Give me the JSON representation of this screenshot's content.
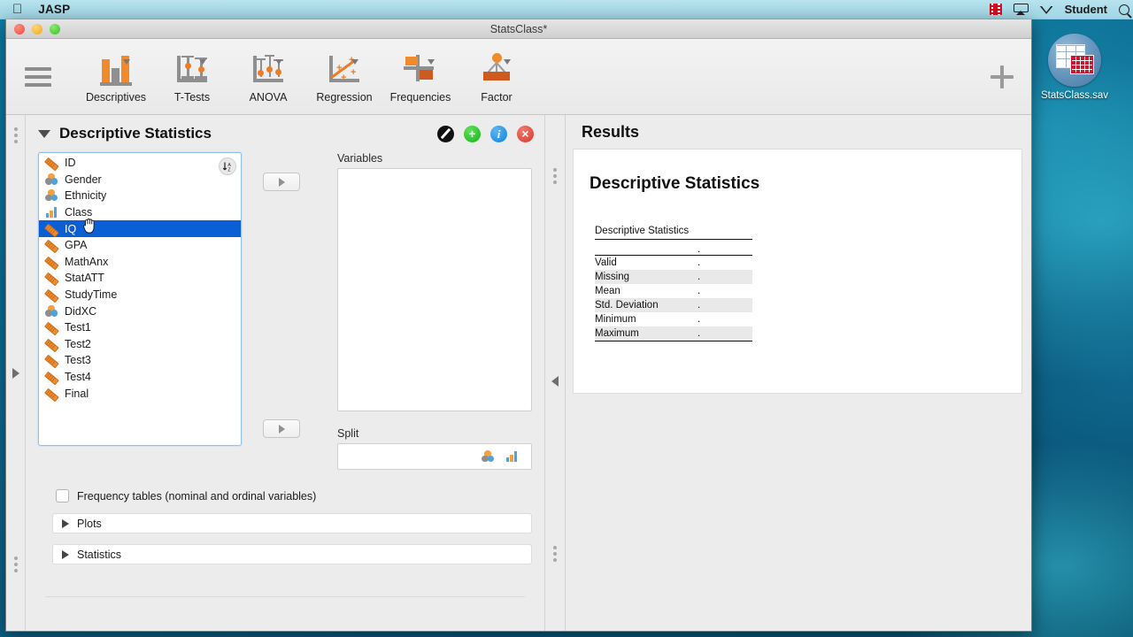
{
  "menubar": {
    "apple_icon": "apple-icon",
    "app_name": "JASP",
    "user": "Student",
    "status_icons": [
      "screen-recorder-icon",
      "airplay-icon",
      "wifi-icon",
      "spotlight-icon"
    ]
  },
  "desktop": {
    "file_icon": {
      "label": "StatsClass.sav",
      "icon": "spss-data-file-icon"
    },
    "wallpaper_color": "#0a6e97"
  },
  "window": {
    "title": "StatsClass*",
    "traffic_lights": [
      "close",
      "minimize",
      "zoom"
    ]
  },
  "ribbon": {
    "menu_icon": "hamburger-icon",
    "add_icon": "plus-icon",
    "items": [
      {
        "label": "Descriptives",
        "icon": "bar-chart-icon"
      },
      {
        "label": "T-Tests",
        "icon": "error-bars-icon"
      },
      {
        "label": "ANOVA",
        "icon": "anova-icon"
      },
      {
        "label": "Regression",
        "icon": "scatter-regression-icon"
      },
      {
        "label": "Frequencies",
        "icon": "crosstab-icon"
      },
      {
        "label": "Factor",
        "icon": "factor-tree-icon"
      }
    ]
  },
  "options": {
    "title": "Descriptive Statistics",
    "collapse_icon": "chevron-down-icon",
    "header_buttons": [
      {
        "name": "no-entry-button",
        "symbol": ""
      },
      {
        "name": "add-button",
        "symbol": "+"
      },
      {
        "name": "info-button",
        "symbol": "i"
      },
      {
        "name": "close-button",
        "symbol": "×"
      }
    ],
    "sort_button": "sort-az-icon",
    "variables_list": [
      {
        "name": "ID",
        "type": "scale",
        "selected": false
      },
      {
        "name": "Gender",
        "type": "nominal",
        "selected": false
      },
      {
        "name": "Ethnicity",
        "type": "nominal",
        "selected": false
      },
      {
        "name": "Class",
        "type": "ordinal",
        "selected": false
      },
      {
        "name": "IQ",
        "type": "scale",
        "selected": true
      },
      {
        "name": "GPA",
        "type": "scale",
        "selected": false
      },
      {
        "name": "MathAnx",
        "type": "scale",
        "selected": false
      },
      {
        "name": "StatATT",
        "type": "scale",
        "selected": false
      },
      {
        "name": "StudyTime",
        "type": "scale",
        "selected": false
      },
      {
        "name": "DidXC",
        "type": "nominal",
        "selected": false
      },
      {
        "name": "Test1",
        "type": "scale",
        "selected": false
      },
      {
        "name": "Test2",
        "type": "scale",
        "selected": false
      },
      {
        "name": "Test3",
        "type": "scale",
        "selected": false
      },
      {
        "name": "Test4",
        "type": "scale",
        "selected": false
      },
      {
        "name": "Final",
        "type": "scale",
        "selected": false
      }
    ],
    "variables_label": "Variables",
    "variables_items": [],
    "split_label": "Split",
    "split_items": [],
    "split_allowed_icons": [
      "nominal-icon",
      "ordinal-icon"
    ],
    "frequency_tables": {
      "label": "Frequency tables (nominal and ordinal variables)",
      "checked": false
    },
    "sections": [
      {
        "label": "Plots",
        "expanded": false
      },
      {
        "label": "Statistics",
        "expanded": false
      }
    ],
    "transfer_buttons": [
      "assign-variables-button",
      "assign-split-button"
    ]
  },
  "results": {
    "header": "Results",
    "heading": "Descriptive Statistics",
    "table": {
      "caption": "Descriptive Statistics",
      "column_header": ".",
      "rows": [
        {
          "label": "Valid",
          "value": ".",
          "shaded": false
        },
        {
          "label": "Missing",
          "value": ".",
          "shaded": true
        },
        {
          "label": "Mean",
          "value": ".",
          "shaded": false
        },
        {
          "label": "Std. Deviation",
          "value": ".",
          "shaded": true
        },
        {
          "label": "Minimum",
          "value": ".",
          "shaded": false
        },
        {
          "label": "Maximum",
          "value": ".",
          "shaded": true
        }
      ]
    }
  },
  "splitters": {
    "left": "left-panel-splitter",
    "middle": "results-panel-splitter"
  },
  "colors": {
    "accent_orange": "#ef8b2c",
    "selection_blue": "#0b5fd4",
    "nominal_blue": "#4fa3dd",
    "window_chrome": "#ececec"
  }
}
